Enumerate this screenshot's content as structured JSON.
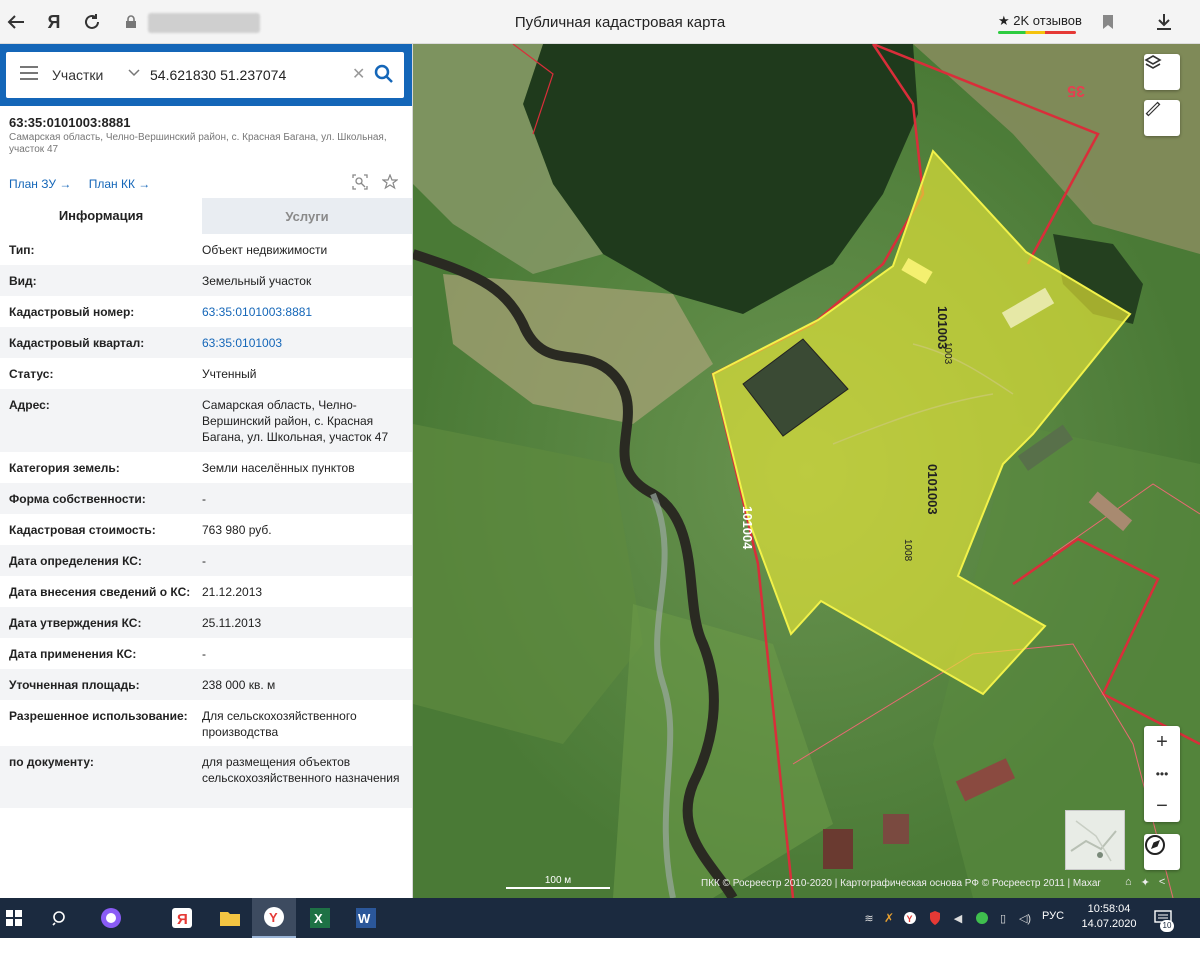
{
  "browser": {
    "title": "Публичная кадастровая карта",
    "reviews": "2K отзывов"
  },
  "search": {
    "type": "Участки",
    "query": "54.621830 51.237074"
  },
  "object": {
    "cadastral_id": "63:35:0101003:8881",
    "address": "Самарская область, Челно-Вершинский район, с. Красная Багана, ул. Школьная, участок 47",
    "plan_zu": "План ЗУ →",
    "plan_kk": "План КК →"
  },
  "tabs": {
    "info": "Информация",
    "services": "Услуги"
  },
  "info": {
    "type_label": "Тип:",
    "type_value": "Объект недвижимости",
    "kind_label": "Вид:",
    "kind_value": "Земельный участок",
    "cadnum_label": "Кадастровый номер:",
    "cadnum_value": "63:35:0101003:8881",
    "quarter_label": "Кадастровый квартал:",
    "quarter_value": "63:35:0101003",
    "status_label": "Статус:",
    "status_value": "Учтенный",
    "address_label": "Адрес:",
    "address_value": "Самарская область, Челно-Вершинский район, с. Красная Багана, ул. Школьная, участок 47",
    "category_label": "Категория земель:",
    "category_value": "Земли населённых пунктов",
    "ownership_label": "Форма собственности:",
    "ownership_value": "-",
    "cost_label": "Кадастровая стоимость:",
    "cost_value": "763 980 руб.",
    "cost_date_label": "Дата определения КС:",
    "cost_date_value": "-",
    "entry_date_label": "Дата внесения сведений о КС:",
    "entry_date_value": "21.12.2013",
    "approve_date_label": "Дата утверждения КС:",
    "approve_date_value": "25.11.2013",
    "apply_date_label": "Дата применения КС:",
    "apply_date_value": "-",
    "area_label": "Уточненная площадь:",
    "area_value": "238 000 кв. м",
    "usage_label": "Разрешенное использование:",
    "usage_value": "Для сельскохозяйственного производства",
    "doc_label": "по документу:",
    "doc_value": "для размещения объектов сельскохозяйственного назначения"
  },
  "map": {
    "labels": [
      "101003",
      "1003",
      "1008",
      "0101003",
      "101004",
      "35"
    ],
    "scale": "100 м",
    "copyright": "ПКК © Росреестр 2010-2020 | Картографическая основа РФ © Росреестр 2011 | Maxar",
    "zoom_in": "+",
    "more": "•••",
    "zoom_out": "−"
  },
  "taskbar": {
    "lang": "РУС",
    "time": "10:58:04",
    "date": "14.07.2020",
    "notif_count": "10"
  },
  "colors": {
    "brand": "#1466b8",
    "parcel_fill": "#e8e838",
    "parcel_border": "#d92e3a"
  }
}
